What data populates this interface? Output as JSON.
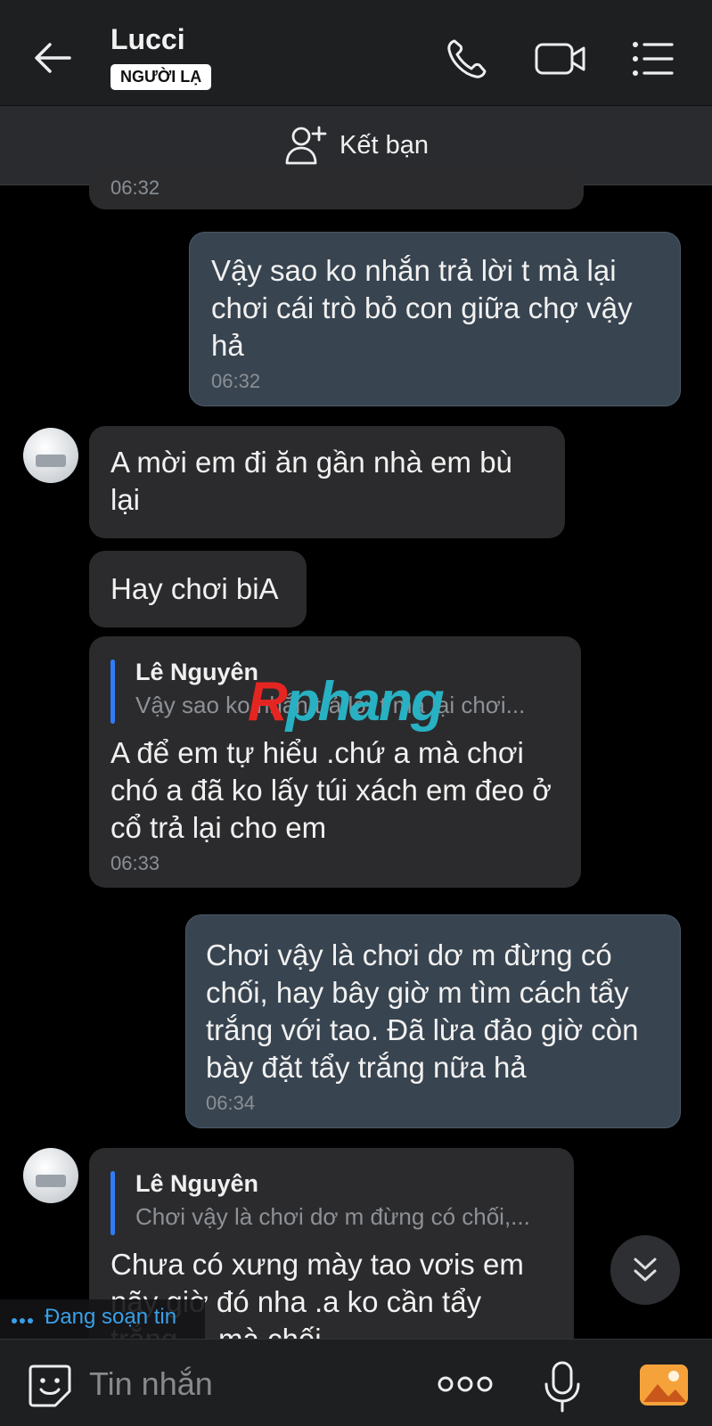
{
  "header": {
    "title": "Lucci",
    "badge": "NGƯỜI LẠ",
    "add_friend_label": "Kết bạn"
  },
  "top_partial": {
    "time": "06:32"
  },
  "messages": [
    {
      "side": "out",
      "text": "Vậy sao ko nhắn trả lời t mà lại chơi cái trò bỏ con giữa chợ vậy hả",
      "time": "06:32"
    },
    {
      "side": "in",
      "text": "A mời em đi ăn gần nhà em bù lại"
    },
    {
      "side": "in",
      "text": "Hay chơi biA"
    },
    {
      "side": "in",
      "quote_name": "Lê Nguyên",
      "quote_text": "Vậy sao ko nhắn trả lời t mà lại chơi...",
      "text": "A để em tự hiểu .chứ a mà chơi chó a đã ko lấy túi xách em đeo ở cổ trả lại cho em",
      "time": "06:33"
    },
    {
      "side": "out",
      "text": "Chơi vậy là chơi dơ m đừng có chối, hay bây giờ m tìm cách tẩy trắng với tao. Đã lừa đảo giờ còn bày đặt tẩy trắng nữa hả",
      "time": "06:34"
    },
    {
      "side": "in",
      "quote_name": "Lê Nguyên",
      "quote_text": "Chơi vậy là chơi dơ m đừng có chối,...",
      "text": "Chưa có xưng mày tao vơis em nãy giờ đó nha .a ko cần tẩy trắng ... mà chối"
    }
  ],
  "watermark": {
    "part1": "R",
    "part2": "phang"
  },
  "typing_indicator": "Đang soạn tin",
  "composer": {
    "placeholder": "Tin nhắn"
  },
  "colors": {
    "background": "#000000",
    "bubble_in": "#2b2b2d",
    "bubble_out": "#384450",
    "accent": "#2f7cf6"
  }
}
